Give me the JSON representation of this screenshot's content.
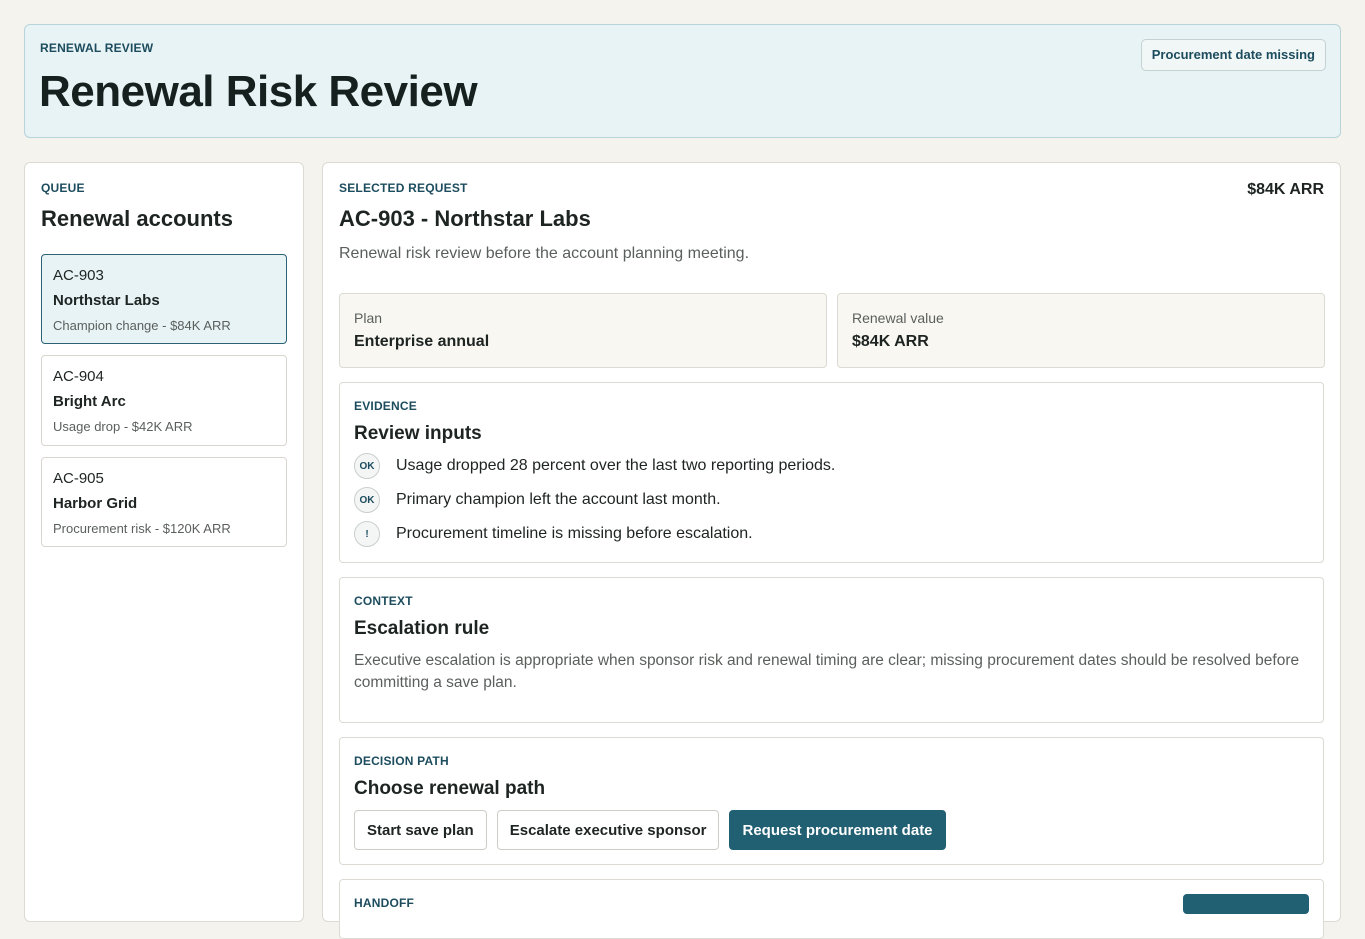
{
  "header": {
    "eyebrow": "RENEWAL REVIEW",
    "title": "Renewal Risk Review",
    "badge": "Procurement date missing"
  },
  "queue": {
    "eyebrow": "QUEUE",
    "title": "Renewal accounts",
    "accounts": [
      {
        "id": "AC-903",
        "name": "Northstar Labs",
        "meta": "Champion change - $84K ARR",
        "selected": true
      },
      {
        "id": "AC-904",
        "name": "Bright Arc",
        "meta": "Usage drop - $42K ARR",
        "selected": false
      },
      {
        "id": "AC-905",
        "name": "Harbor Grid",
        "meta": "Procurement risk - $120K ARR",
        "selected": false
      }
    ]
  },
  "detail": {
    "eyebrow": "SELECTED REQUEST",
    "arr": "$84K ARR",
    "title": "AC-903 - Northstar Labs",
    "description": "Renewal risk review before the account planning meeting.",
    "stats": [
      {
        "label": "Plan",
        "value": "Enterprise annual"
      },
      {
        "label": "Renewal value",
        "value": "$84K ARR"
      }
    ],
    "evidence": {
      "eyebrow": "EVIDENCE",
      "title": "Review inputs",
      "items": [
        {
          "status": "OK",
          "text": "Usage dropped 28 percent over the last two reporting periods."
        },
        {
          "status": "OK",
          "text": "Primary champion left the account last month."
        },
        {
          "status": "!",
          "text": "Procurement timeline is missing before escalation."
        }
      ]
    },
    "context": {
      "eyebrow": "CONTEXT",
      "title": "Escalation rule",
      "text": "Executive escalation is appropriate when sponsor risk and renewal timing are clear; missing procurement dates should be resolved before committing a save plan."
    },
    "decision": {
      "eyebrow": "DECISION PATH",
      "title": "Choose renewal path",
      "buttons": [
        "Start save plan",
        "Escalate executive sponsor",
        "Request procurement date"
      ]
    },
    "handoff": {
      "eyebrow": "HANDOFF"
    }
  }
}
